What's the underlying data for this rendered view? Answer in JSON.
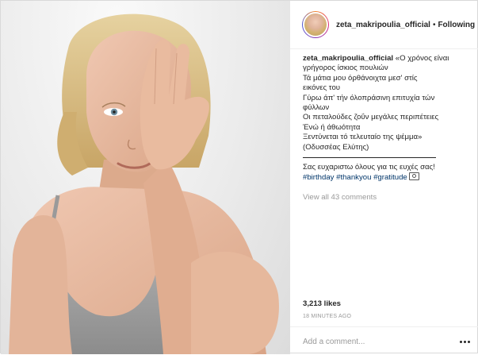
{
  "post": {
    "username": "zeta_makripoulia_official",
    "separator": "•",
    "follow_label": "Following",
    "caption": {
      "user": "zeta_makripoulia_official",
      "lines": [
        "«Ο χρόνος είναι",
        "γρήγορος ίσκιος πουλιών",
        "Τά μάτια μου όρθάνοιχτα μεσ' στίς",
        "εικόνες του",
        "Γύρω άπ' τήν όλοπράσινη επιτυχία τών",
        "φύλλων",
        "Οι πεταλούδες ζοΰν μεγάλες περιπέτειες",
        "Ένώ ή άθωότητα",
        "Ξεντύνεται τό τελευταίο της ψέμμα»",
        "(Οδυσσέας Ελύτης)"
      ],
      "thanks": "Σας ευχαριστω όλους για τις ευχές σας!",
      "hashtags": [
        "#birthday",
        "#thankyou",
        "#gratitude"
      ],
      "trailing_icon": "camera-icon"
    },
    "view_all_comments": "View all 43 comments",
    "likes": "3,213 likes",
    "timestamp": "18 MINUTES AGO",
    "comment_placeholder": "Add a comment...",
    "more_icon": "more-options-icon"
  }
}
